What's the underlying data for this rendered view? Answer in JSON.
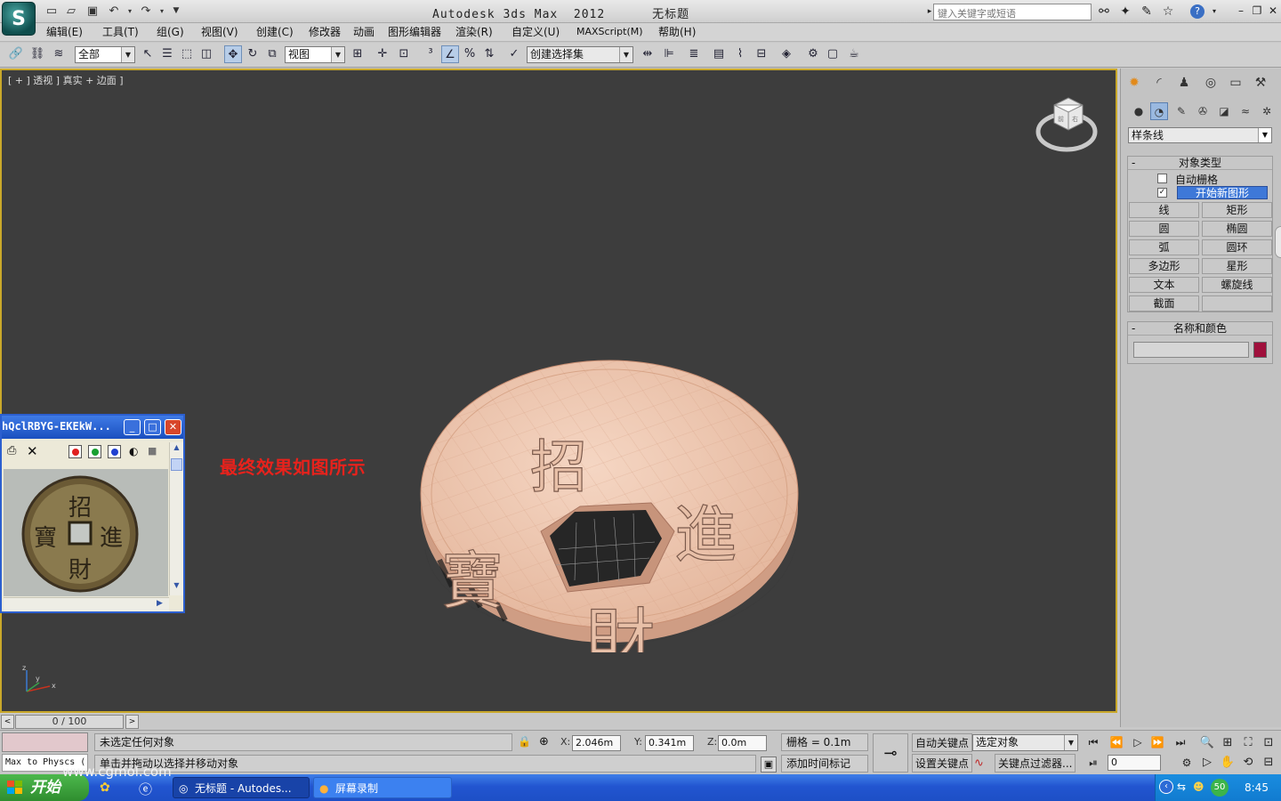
{
  "window": {
    "title": "Autodesk 3ds Max  2012      无标题",
    "search_placeholder": "键入关键字或短语"
  },
  "menu": [
    "编辑(E)",
    "工具(T)",
    "组(G)",
    "视图(V)",
    "创建(C)",
    "修改器",
    "动画",
    "图形编辑器",
    "渲染(R)",
    "自定义(U)",
    "MAXScript(M)",
    "帮助(H)"
  ],
  "toolbar": {
    "filter_select": "全部",
    "coord_select": "视图",
    "named_selection": "创建选择集"
  },
  "viewport": {
    "label": "[ + ] 透视 ] 真实 + 边面 ]",
    "caption": "最终效果如图所示",
    "coin_chars": [
      "招",
      "進",
      "財",
      "寶"
    ]
  },
  "image_viewer": {
    "title": "hQclRBYG-EKEkW...",
    "coin_chars": [
      "招",
      "進",
      "財",
      "寶"
    ]
  },
  "command_panel": {
    "category": "样条线",
    "object_type_header": "对象类型",
    "autogrid_label": "自动栅格",
    "start_new_shape_label": "开始新图形",
    "start_new_shape_checked": true,
    "buttons": [
      "线",
      "矩形",
      "圆",
      "椭圆",
      "弧",
      "圆环",
      "多边形",
      "星形",
      "文本",
      "螺旋线",
      "截面"
    ],
    "name_color_header": "名称和颜色",
    "object_color": "#a0103c"
  },
  "timeline": {
    "frame_label": "0 / 100"
  },
  "status": {
    "script_listener": "Max to Physcs (",
    "selection_info": "未选定任何对象",
    "prompt": "单击并拖动以选择并移动对象",
    "x_label": "X:",
    "x_value": "2.046m",
    "y_label": "Y:",
    "y_value": "0.341m",
    "z_label": "Z:",
    "z_value": "0.0m",
    "grid": "栅格 = 0.1m",
    "add_time_tag": "添加时间标记",
    "auto_key": "自动关键点",
    "set_key": "设置关键点",
    "key_mode_select": "选定对象",
    "key_filters": "关键点过滤器...",
    "frame_value": "0"
  },
  "taskbar": {
    "start_label": "开始",
    "items": [
      "无标题 - Autodes...",
      "屏幕录制"
    ],
    "clock": "8:45",
    "tray_badge": "50",
    "watermark": "www.cgmol.com"
  }
}
